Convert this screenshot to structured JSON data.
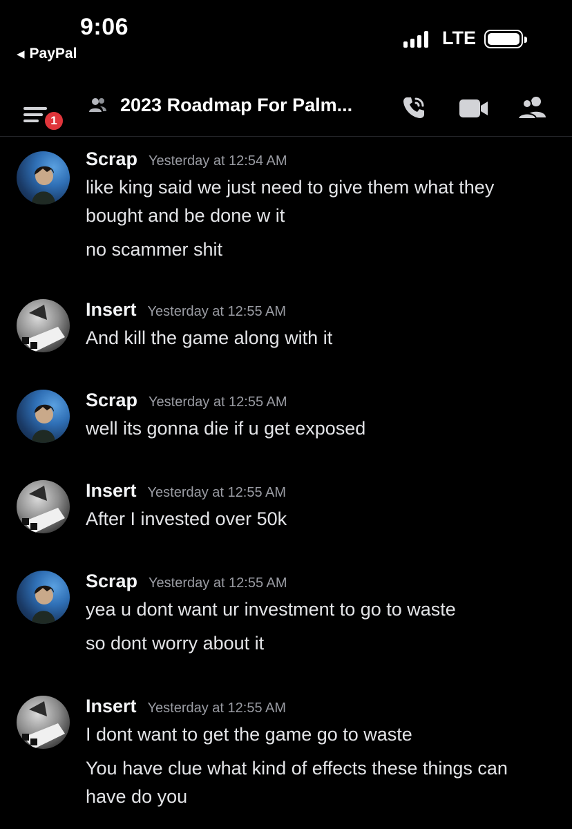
{
  "status_bar": {
    "time": "9:06",
    "back_app": "PayPal",
    "network": "LTE"
  },
  "header": {
    "channel_title": "2023 Roadmap For Palm...",
    "notification_count": "1",
    "icons": [
      "menu-icon",
      "group-dm-icon",
      "phone-call-icon",
      "video-call-icon",
      "members-icon"
    ]
  },
  "messages": [
    {
      "author": "Scrap",
      "timestamp": "Yesterday at 12:54 AM",
      "lines": [
        "like king said we just need to give them what they bought and be done w it",
        "no scammer shit"
      ]
    },
    {
      "author": "Insert",
      "timestamp": "Yesterday at 12:55 AM",
      "lines": [
        "And kill the game along with it"
      ]
    },
    {
      "author": "Scrap",
      "timestamp": "Yesterday at 12:55 AM",
      "lines": [
        "well its gonna die if u get exposed"
      ]
    },
    {
      "author": "Insert",
      "timestamp": "Yesterday at 12:55 AM",
      "lines": [
        "After I invested over 50k"
      ]
    },
    {
      "author": "Scrap",
      "timestamp": "Yesterday at 12:55 AM",
      "lines": [
        "yea u dont want ur investment to go to waste",
        "so dont worry about it"
      ]
    },
    {
      "author": "Insert",
      "timestamp": "Yesterday at 12:55 AM",
      "lines": [
        "I dont want to get the game go to waste",
        "You have clue what kind of effects these things can have do you"
      ]
    }
  ],
  "colors": {
    "background": "#000000",
    "badge": "#e0353b",
    "timestamp": "#9a9ca3",
    "text": "#e3e4e7"
  }
}
